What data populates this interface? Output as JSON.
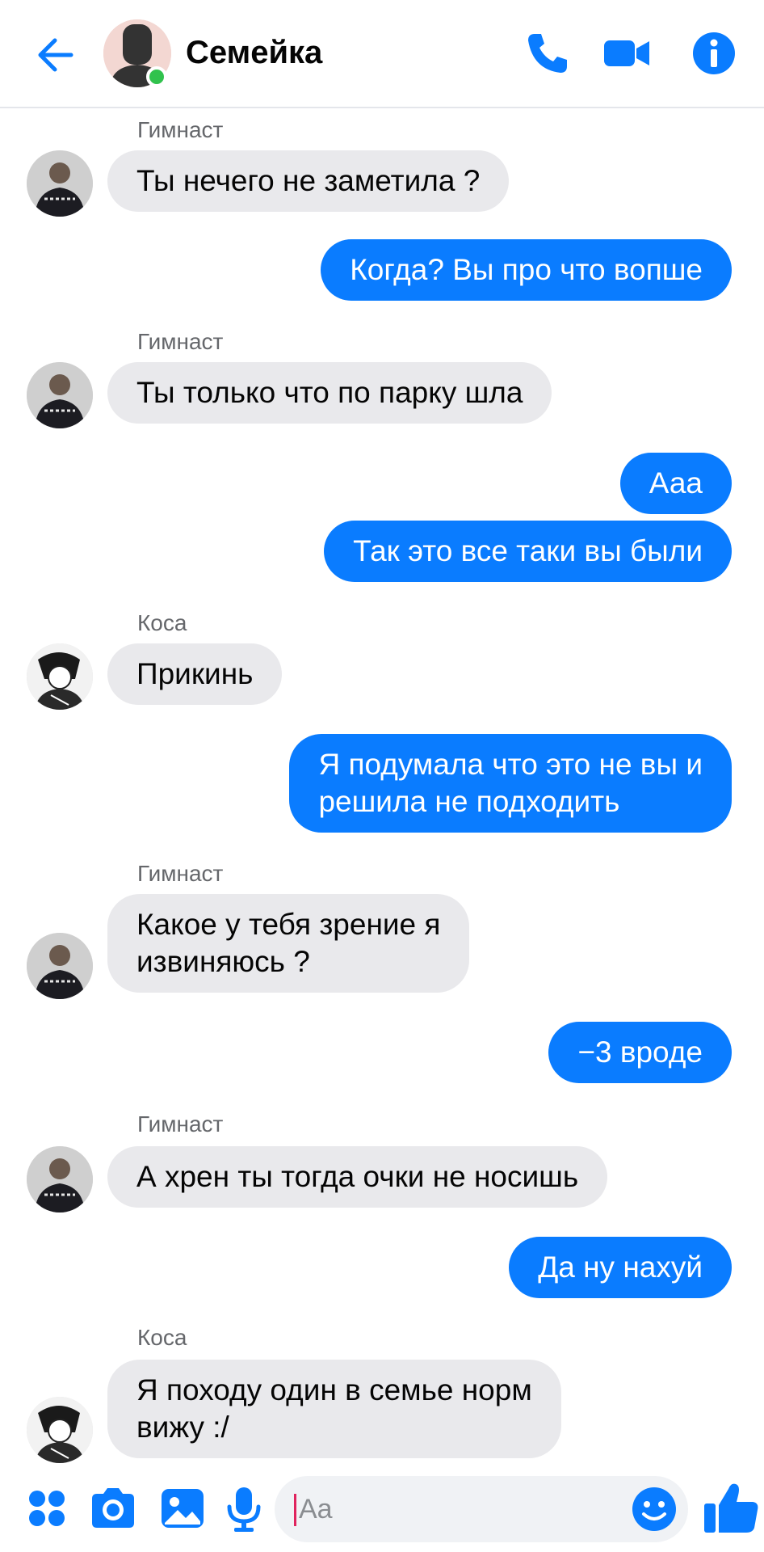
{
  "header": {
    "title": "Семейка",
    "back_icon": "arrow-left-icon",
    "call_icon": "phone-icon",
    "video_icon": "video-camera-icon",
    "info_icon": "info-icon",
    "online": true
  },
  "messages": [
    {
      "sender": "Гимнаст",
      "side": "in",
      "text": "Ты нечего не заметила ?"
    },
    {
      "side": "out",
      "text": "Когда? Вы про что вопше"
    },
    {
      "sender": "Гимнаст",
      "side": "in",
      "text": "Ты только что по парку шла"
    },
    {
      "side": "out",
      "text": "Ааа"
    },
    {
      "side": "out",
      "text": "Так это все таки вы были"
    },
    {
      "sender": "Коса",
      "side": "in",
      "text": "Прикинь"
    },
    {
      "side": "out",
      "text": "Я подумала что это не вы и\nрешила не подходить"
    },
    {
      "sender": "Гимнаст",
      "side": "in",
      "text": "Какое у тебя зрение я\nизвиняюсь ?"
    },
    {
      "side": "out",
      "text": "−3 вроде"
    },
    {
      "sender": "Гимнаст",
      "side": "in",
      "text": "А хрен ты тогда очки не носишь"
    },
    {
      "side": "out",
      "text": "Да ну нахуй"
    },
    {
      "sender": "Коса",
      "side": "in",
      "text": "Я походу один в семье норм\nвижу :/"
    }
  ],
  "composer": {
    "placeholder": "Aa",
    "icons": [
      "apps-icon",
      "camera-icon",
      "image-icon",
      "microphone-icon",
      "emoji-icon",
      "thumbs-up-icon"
    ]
  },
  "colors": {
    "accent": "#0a7cff",
    "incoming_bubble": "#e9e9ec",
    "online": "#31c24d"
  }
}
